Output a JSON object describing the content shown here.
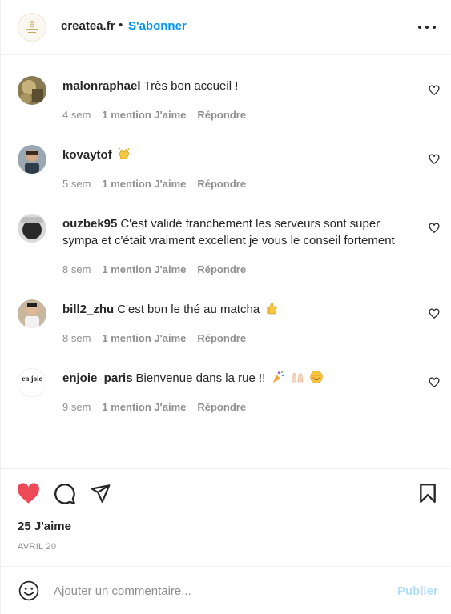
{
  "header": {
    "account": "createa.fr",
    "separator": "•",
    "follow_label": "S'abonner"
  },
  "comments": [
    {
      "user": "malonraphael",
      "text": "Très bon accueil !",
      "age": "4 sem",
      "likes": "1 mention J'aime",
      "reply": "Répondre"
    },
    {
      "user": "kovaytof",
      "text": "",
      "emoji": [
        "clapping-hands"
      ],
      "age": "5 sem",
      "likes": "1 mention J'aime",
      "reply": "Répondre"
    },
    {
      "user": "ouzbek95",
      "text": "C'est validé franchement les serveurs sont super sympa et c'était vraiment excellent je vous le conseil fortement",
      "age": "8 sem",
      "likes": "1 mention J'aime",
      "reply": "Répondre"
    },
    {
      "user": "bill2_zhu",
      "text": "C'est bon le thé au matcha",
      "emoji": [
        "thumbs-up"
      ],
      "age": "8 sem",
      "likes": "1 mention J'aime",
      "reply": "Répondre"
    },
    {
      "user": "enjoie_paris",
      "text": "Bienvenue dans la rue !!",
      "emoji": [
        "party-popper",
        "raising-hands",
        "smiling-face"
      ],
      "age": "9 sem",
      "likes": "1 mention J'aime",
      "reply": "Répondre"
    }
  ],
  "enjoie_logo_text": "en joie",
  "post": {
    "likes_label": "25 J'aime",
    "date": "AVRIL 20",
    "liked": true
  },
  "comment_box": {
    "placeholder": "Ajouter un commentaire...",
    "publish_label": "Publier"
  },
  "colors": {
    "accent": "#0095f6",
    "like_red": "#ed4956",
    "muted": "#8e8e8e",
    "publish_disabled": "#b2dffc"
  }
}
